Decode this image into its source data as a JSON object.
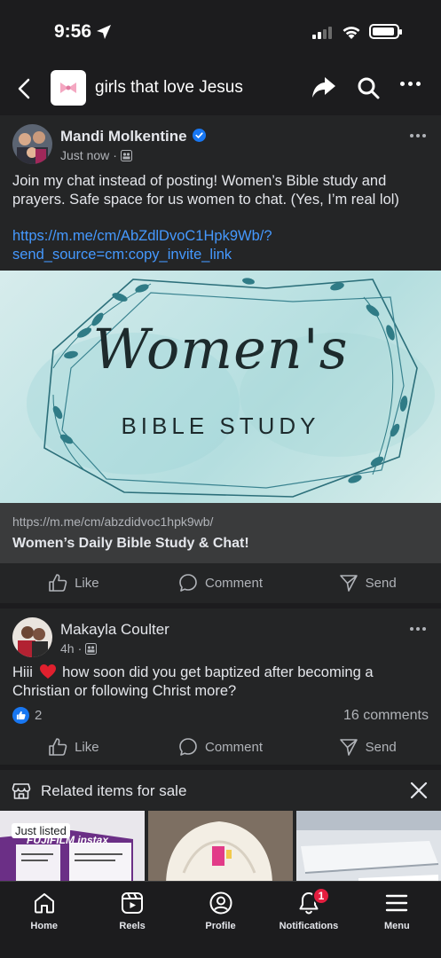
{
  "status_bar": {
    "time": "9:56"
  },
  "header": {
    "group_name": "girls that love Jesus"
  },
  "post1": {
    "author": "Mandi Molkentine",
    "timestamp": "Just now",
    "text": "Join my chat instead of posting! Women’s Bible study and prayers. Safe space for us women to chat. (Yes, I’m real lol)",
    "link_line1": "https://m.me/cm/AbZdlDvoC1Hpk9Wb/?",
    "link_line2": "send_source=cm:copy_invite_link",
    "image_script": "Women's",
    "image_caption": "BIBLE STUDY",
    "card_url": "https://m.me/cm/abzdidvoc1hpk9wb/",
    "card_title": "Women’s Daily Bible Study & Chat!",
    "actions": {
      "like": "Like",
      "comment": "Comment",
      "send": "Send"
    }
  },
  "post2": {
    "author": "Makayla Coulter",
    "timestamp": "4h",
    "text_before": "Hiii",
    "text_after": "how soon did you get baptized after becoming a Christian or following Christ more?",
    "reaction_count": "2",
    "comment_count": "16 comments",
    "actions": {
      "like": "Like",
      "comment": "Comment",
      "send": "Send"
    }
  },
  "related": {
    "title": "Related items for sale",
    "badge": "Just listed",
    "item1_brand": "FUJIFILM instax"
  },
  "nav": {
    "home": "Home",
    "reels": "Reels",
    "profile": "Profile",
    "notifications": "Notifications",
    "notifications_badge": "1",
    "menu": "Menu"
  },
  "colors": {
    "background": "#1c1c1e",
    "card": "#242526",
    "link": "#4599ff",
    "verified": "#1877f2",
    "badge": "#e41e3f"
  }
}
